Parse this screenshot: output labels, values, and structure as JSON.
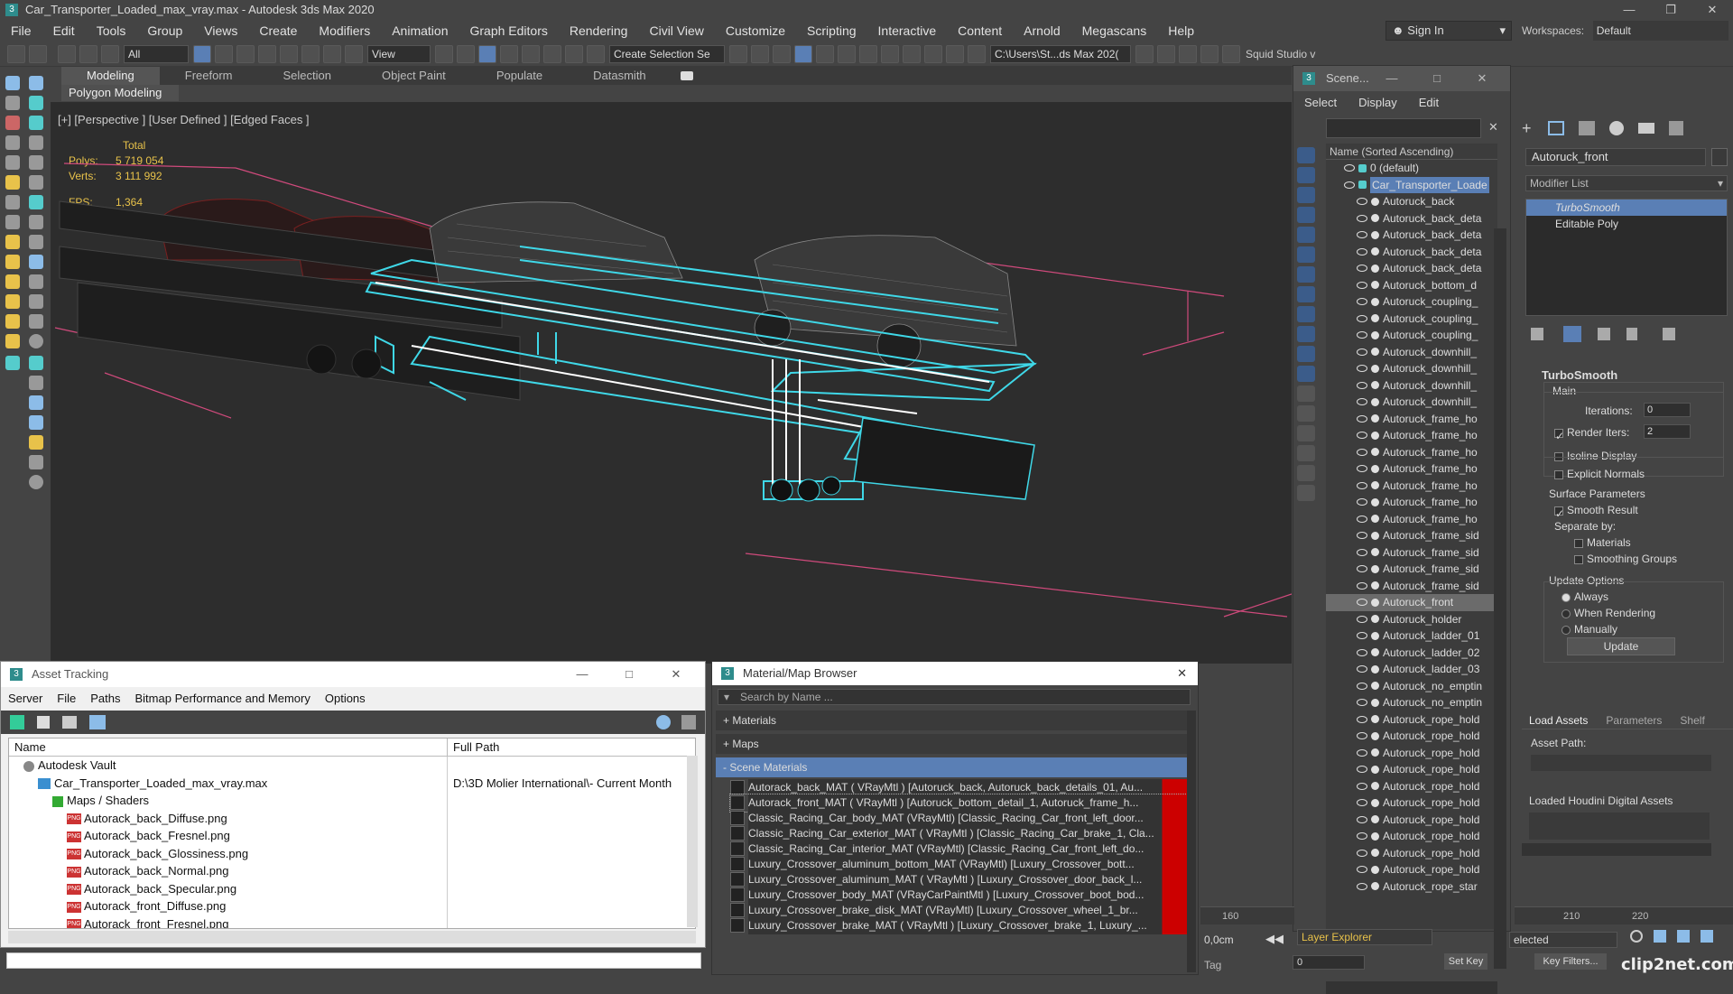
{
  "window": {
    "title": "Car_Transporter_Loaded_max_vray.max - Autodesk 3ds Max 2020"
  },
  "menubar": {
    "items": [
      "File",
      "Edit",
      "Tools",
      "Group",
      "Views",
      "Create",
      "Modifiers",
      "Animation",
      "Graph Editors",
      "Rendering",
      "Civil View",
      "Customize",
      "Scripting",
      "Interactive",
      "Content",
      "Arnold",
      "Megascans",
      "Help"
    ],
    "signin": "Sign In",
    "workspace_label": "Workspaces:",
    "workspace_value": "Default"
  },
  "toolbar": {
    "filter_value": "All",
    "ref_coord": "View",
    "selection_set": "Create Selection Se",
    "path": "C:\\Users\\St...ds Max 202(",
    "squid": "Squid Studio v"
  },
  "ribbon": {
    "tabs": [
      "Modeling",
      "Freeform",
      "Selection",
      "Object Paint",
      "Populate",
      "Datasmith"
    ],
    "active": "Modeling",
    "panel": "Polygon Modeling"
  },
  "viewport": {
    "label": "[+] [Perspective ] [User Defined ] [Edged Faces ]",
    "stats": {
      "total_label": "Total",
      "polys_label": "Polys:",
      "polys": "5 719 054",
      "verts_label": "Verts:",
      "verts": "3 111 992",
      "fps_label": "FPS:",
      "fps": "1,364"
    }
  },
  "scene_explorer": {
    "title": "Scene...",
    "menu": [
      "Select",
      "Display",
      "Edit"
    ],
    "column": "Name (Sorted Ascending)",
    "items": [
      {
        "name": "0 (default)",
        "level": 0,
        "type": "layer"
      },
      {
        "name": "Car_Transporter_Loade",
        "level": 0,
        "type": "layer",
        "state": "blue"
      },
      {
        "name": "Autoruck_back",
        "level": 1
      },
      {
        "name": "Autoruck_back_deta",
        "level": 1
      },
      {
        "name": "Autoruck_back_deta",
        "level": 1
      },
      {
        "name": "Autoruck_back_deta",
        "level": 1
      },
      {
        "name": "Autoruck_back_deta",
        "level": 1
      },
      {
        "name": "Autoruck_bottom_d",
        "level": 1
      },
      {
        "name": "Autoruck_coupling_",
        "level": 1
      },
      {
        "name": "Autoruck_coupling_",
        "level": 1
      },
      {
        "name": "Autoruck_coupling_",
        "level": 1
      },
      {
        "name": "Autoruck_downhill_",
        "level": 1
      },
      {
        "name": "Autoruck_downhill_",
        "level": 1
      },
      {
        "name": "Autoruck_downhill_",
        "level": 1
      },
      {
        "name": "Autoruck_downhill_",
        "level": 1
      },
      {
        "name": "Autoruck_frame_ho",
        "level": 1
      },
      {
        "name": "Autoruck_frame_ho",
        "level": 1
      },
      {
        "name": "Autoruck_frame_ho",
        "level": 1
      },
      {
        "name": "Autoruck_frame_ho",
        "level": 1
      },
      {
        "name": "Autoruck_frame_ho",
        "level": 1
      },
      {
        "name": "Autoruck_frame_ho",
        "level": 1
      },
      {
        "name": "Autoruck_frame_ho",
        "level": 1
      },
      {
        "name": "Autoruck_frame_sid",
        "level": 1
      },
      {
        "name": "Autoruck_frame_sid",
        "level": 1
      },
      {
        "name": "Autoruck_frame_sid",
        "level": 1
      },
      {
        "name": "Autoruck_frame_sid",
        "level": 1
      },
      {
        "name": "Autoruck_front",
        "level": 1,
        "state": "sel"
      },
      {
        "name": "Autoruck_holder",
        "level": 1
      },
      {
        "name": "Autoruck_ladder_01",
        "level": 1
      },
      {
        "name": "Autoruck_ladder_02",
        "level": 1
      },
      {
        "name": "Autoruck_ladder_03",
        "level": 1
      },
      {
        "name": "Autoruck_no_emptin",
        "level": 1
      },
      {
        "name": "Autoruck_no_emptin",
        "level": 1
      },
      {
        "name": "Autoruck_rope_hold",
        "level": 1
      },
      {
        "name": "Autoruck_rope_hold",
        "level": 1
      },
      {
        "name": "Autoruck_rope_hold",
        "level": 1
      },
      {
        "name": "Autoruck_rope_hold",
        "level": 1
      },
      {
        "name": "Autoruck_rope_hold",
        "level": 1
      },
      {
        "name": "Autoruck_rope_hold",
        "level": 1
      },
      {
        "name": "Autoruck_rope_hold",
        "level": 1
      },
      {
        "name": "Autoruck_rope_hold",
        "level": 1
      },
      {
        "name": "Autoruck_rope_hold",
        "level": 1
      },
      {
        "name": "Autoruck_rope_hold",
        "level": 1
      },
      {
        "name": "Autoruck_rope_star",
        "level": 1
      }
    ],
    "layer_explorer": "Layer Explorer"
  },
  "command_panel": {
    "object_name": "Autoruck_front",
    "modifier_list": "Modifier List",
    "stack": [
      "TurboSmooth",
      "Editable Poly"
    ],
    "turbosmooth": {
      "title": "TurboSmooth",
      "main": "Main",
      "iterations_label": "Iterations:",
      "iterations": "0",
      "render_iters_label": "Render Iters:",
      "render_iters": "2",
      "isoline": "Isoline Display",
      "explicit": "Explicit Normals",
      "surface": "Surface Parameters",
      "smooth_result": "Smooth Result",
      "separate_by": "Separate by:",
      "materials": "Materials",
      "smoothing_groups": "Smoothing Groups",
      "update_options": "Update Options",
      "always": "Always",
      "when_rendering": "When Rendering",
      "manually": "Manually",
      "update": "Update"
    },
    "houdini": {
      "tabs": [
        "Load Assets",
        "Parameters",
        "Shelf"
      ],
      "asset_path": "Asset Path:",
      "loaded": "Loaded Houdini Digital Assets"
    }
  },
  "asset_tracking": {
    "title": "Asset Tracking",
    "menu": [
      "Server",
      "File",
      "Paths",
      "Bitmap Performance and Memory",
      "Options"
    ],
    "col_name": "Name",
    "col_path": "Full Path",
    "rows": [
      {
        "name": "Autodesk Vault",
        "path": "",
        "indent": 1
      },
      {
        "name": "Car_Transporter_Loaded_max_vray.max",
        "path": "D:\\3D Molier International\\- Current Month",
        "indent": 2
      },
      {
        "name": "Maps / Shaders",
        "path": "",
        "indent": 3
      },
      {
        "name": "Autorack_back_Diffuse.png",
        "path": "",
        "indent": 4
      },
      {
        "name": "Autorack_back_Fresnel.png",
        "path": "",
        "indent": 4
      },
      {
        "name": "Autorack_back_Glossiness.png",
        "path": "",
        "indent": 4
      },
      {
        "name": "Autorack_back_Normal.png",
        "path": "",
        "indent": 4
      },
      {
        "name": "Autorack_back_Specular.png",
        "path": "",
        "indent": 4
      },
      {
        "name": "Autorack_front_Diffuse.png",
        "path": "",
        "indent": 4
      },
      {
        "name": "Autorack_front_Fresnel.png",
        "path": "",
        "indent": 4
      }
    ]
  },
  "material_browser": {
    "title": "Material/Map Browser",
    "search_placeholder": "Search by Name ...",
    "sections": [
      "+ Materials",
      "+ Maps",
      "- Scene Materials"
    ],
    "materials": [
      "Autorack_back_MAT ( VRayMtl ) [Autoruck_back, Autoruck_back_details_01, Au...",
      "Autorack_front_MAT ( VRayMtl ) [Autoruck_bottom_detail_1, Autoruck_frame_h...",
      "Classic_Racing_Car_body_MAT (VRayMtl) [Classic_Racing_Car_front_left_door...",
      "Classic_Racing_Car_exterior_MAT ( VRayMtl ) [Classic_Racing_Car_brake_1, Cla...",
      "Classic_Racing_Car_interior_MAT (VRayMtl) [Classic_Racing_Car_front_left_do...",
      "Luxury_Crossover_aluminum_bottom_MAT (VRayMtl) [Luxury_Crossover_bott...",
      "Luxury_Crossover_aluminum_MAT ( VRayMtl ) [Luxury_Crossover_door_back_l...",
      "Luxury_Crossover_body_MAT (VRayCarPaintMtl ) [Luxury_Crossover_boot_bod...",
      "Luxury_Crossover_brake_disk_MAT (VRayMtl) [Luxury_Crossover_wheel_1_br...",
      "Luxury_Crossover_brake_MAT ( VRayMtl ) [Luxury_Crossover_brake_1, Luxury_..."
    ]
  },
  "timeline": {
    "ticks": [
      "160",
      "210",
      "220"
    ],
    "coord": "0,0cm",
    "frame": "0",
    "tag": "Tag",
    "selected": "elected",
    "set_key": "Set Key",
    "key_filters": "Key Filters..."
  },
  "colors": {
    "accent": "#5a7fb5",
    "viewport_bg": "#2d2d2d",
    "selection_cyan": "#3fd8e8",
    "stats_yellow": "#e8c24a",
    "bbox_pink": "#d04a7c"
  }
}
